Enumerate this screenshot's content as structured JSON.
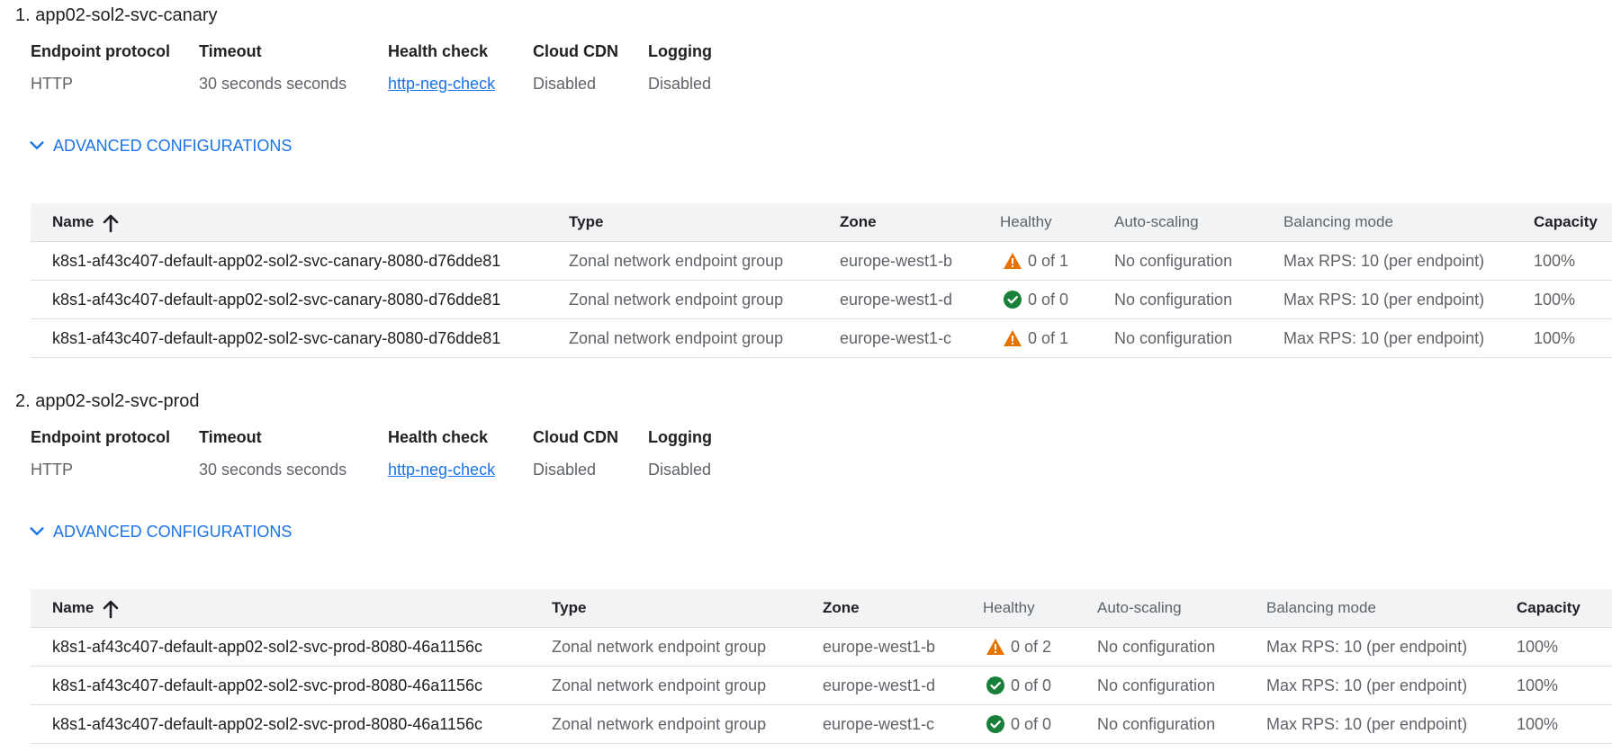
{
  "sections": [
    {
      "title": "1. app02-sol2-svc-canary",
      "properties": {
        "headers": [
          "Endpoint protocol",
          "Timeout",
          "Health check",
          "Cloud CDN",
          "Logging"
        ],
        "values": [
          "HTTP",
          "30 seconds seconds",
          "http-neg-check",
          "Disabled",
          "Disabled"
        ]
      },
      "advanced_label": "ADVANCED CONFIGURATIONS",
      "table": {
        "columns": [
          "Name",
          "Type",
          "Zone",
          "Healthy",
          "Auto-scaling",
          "Balancing mode",
          "Capacity"
        ],
        "rows": [
          {
            "name": "k8s1-af43c407-default-app02-sol2-svc-canary-8080-d76dde81",
            "type": "Zonal network endpoint group",
            "zone": "europe-west1-b",
            "status_icon": "warning-icon",
            "healthy": "0 of 1",
            "autoscaling": "No configuration",
            "balancing": "Max RPS: 10 (per endpoint)",
            "capacity": "100%"
          },
          {
            "name": "k8s1-af43c407-default-app02-sol2-svc-canary-8080-d76dde81",
            "type": "Zonal network endpoint group",
            "zone": "europe-west1-d",
            "status_icon": "check-circle-icon",
            "healthy": "0 of 0",
            "autoscaling": "No configuration",
            "balancing": "Max RPS: 10 (per endpoint)",
            "capacity": "100%"
          },
          {
            "name": "k8s1-af43c407-default-app02-sol2-svc-canary-8080-d76dde81",
            "type": "Zonal network endpoint group",
            "zone": "europe-west1-c",
            "status_icon": "warning-icon",
            "healthy": "0 of 1",
            "autoscaling": "No configuration",
            "balancing": "Max RPS: 10 (per endpoint)",
            "capacity": "100%"
          }
        ]
      }
    },
    {
      "title": "2. app02-sol2-svc-prod",
      "properties": {
        "headers": [
          "Endpoint protocol",
          "Timeout",
          "Health check",
          "Cloud CDN",
          "Logging"
        ],
        "values": [
          "HTTP",
          "30 seconds seconds",
          "http-neg-check",
          "Disabled",
          "Disabled"
        ]
      },
      "advanced_label": "ADVANCED CONFIGURATIONS",
      "table": {
        "columns": [
          "Name",
          "Type",
          "Zone",
          "Healthy",
          "Auto-scaling",
          "Balancing mode",
          "Capacity"
        ],
        "rows": [
          {
            "name": "k8s1-af43c407-default-app02-sol2-svc-prod-8080-46a1156c",
            "type": "Zonal network endpoint group",
            "zone": "europe-west1-b",
            "status_icon": "warning-icon",
            "healthy": "0 of 2",
            "autoscaling": "No configuration",
            "balancing": "Max RPS: 10 (per endpoint)",
            "capacity": "100%"
          },
          {
            "name": "k8s1-af43c407-default-app02-sol2-svc-prod-8080-46a1156c",
            "type": "Zonal network endpoint group",
            "zone": "europe-west1-d",
            "status_icon": "check-circle-icon",
            "healthy": "0 of 0",
            "autoscaling": "No configuration",
            "balancing": "Max RPS: 10 (per endpoint)",
            "capacity": "100%"
          },
          {
            "name": "k8s1-af43c407-default-app02-sol2-svc-prod-8080-46a1156c",
            "type": "Zonal network endpoint group",
            "zone": "europe-west1-c",
            "status_icon": "check-circle-icon",
            "healthy": "0 of 0",
            "autoscaling": "No configuration",
            "balancing": "Max RPS: 10 (per endpoint)",
            "capacity": "100%"
          }
        ]
      }
    }
  ],
  "colors": {
    "link": "#1a73e8",
    "warning": "#e37400",
    "healthy": "#188038",
    "header_bg": "#f1f3f4"
  }
}
